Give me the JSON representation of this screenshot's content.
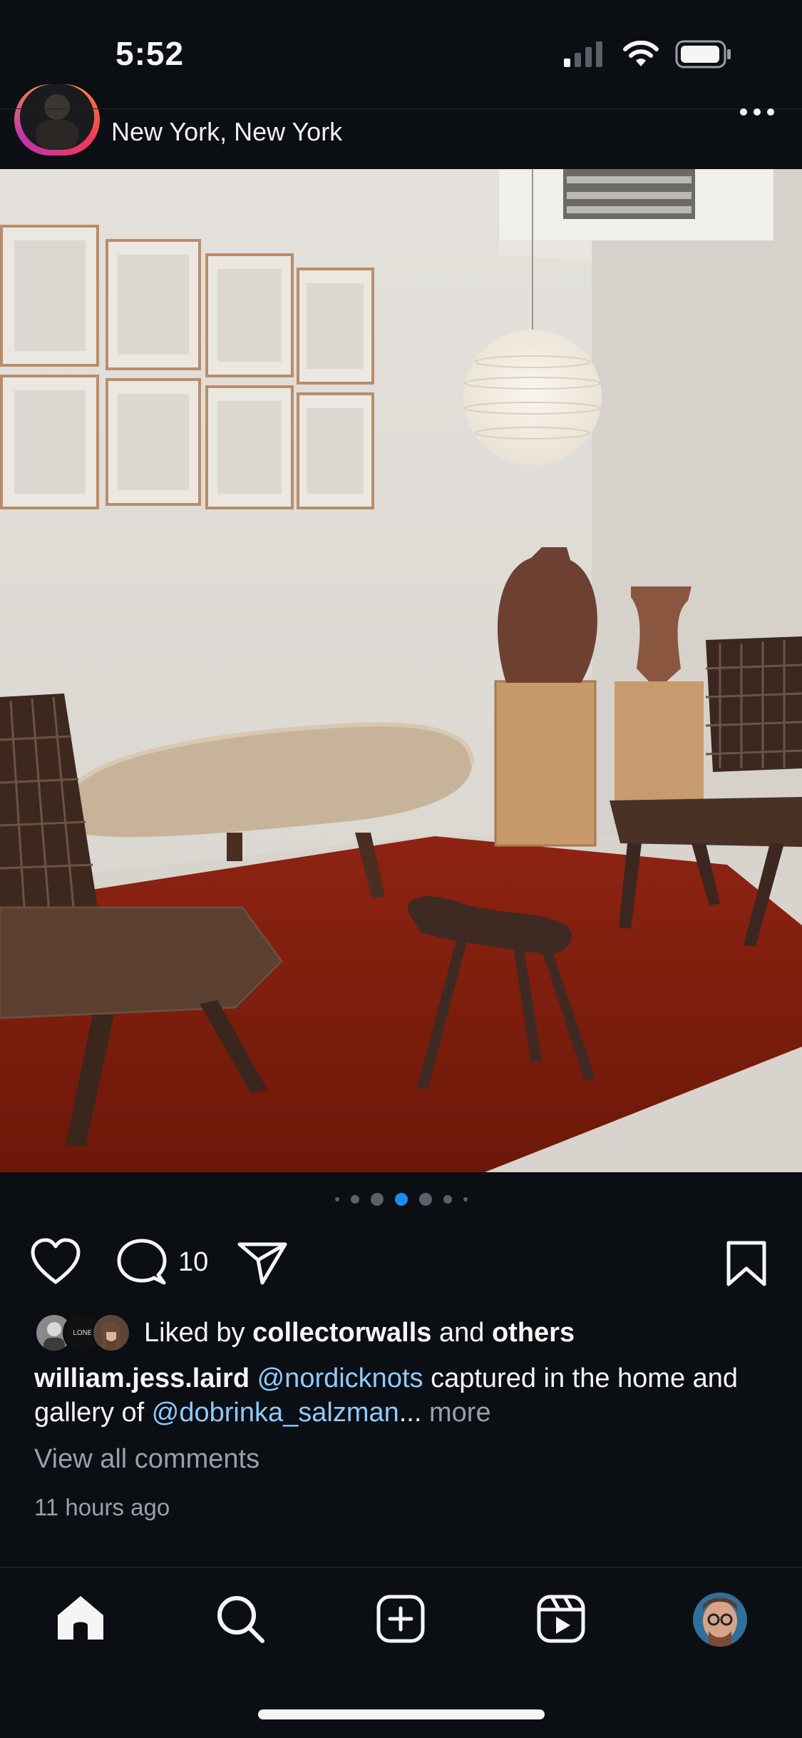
{
  "status_bar": {
    "time": "5:52"
  },
  "post": {
    "location": "New York, New York",
    "carousel": {
      "count": 7,
      "active_index": 3
    },
    "comment_count": "10",
    "likes": {
      "prefix": "Liked by",
      "user": "collectorwalls",
      "connector": "and",
      "suffix": "others"
    },
    "likes_avatar_2_text": "LONE",
    "caption": {
      "author": "william.jess.laird",
      "mention1": "@nordicknots",
      "text1": "captured in the home and gallery of",
      "mention2": "@dobrinka_salzman",
      "ellipsis": "...",
      "more": "more"
    },
    "view_comments": "View all comments",
    "timestamp": "11 hours ago"
  },
  "colors": {
    "background": "#0b0e13",
    "accent_blue": "#1a8cf0",
    "mention": "#8fc9ff",
    "rug": "#8c1f10"
  },
  "icons": [
    "signal-icon",
    "wifi-icon",
    "battery-icon",
    "more-icon",
    "heart-icon",
    "comment-icon",
    "share-icon",
    "bookmark-icon",
    "home-icon",
    "search-icon",
    "create-icon",
    "reels-icon",
    "profile-avatar"
  ]
}
